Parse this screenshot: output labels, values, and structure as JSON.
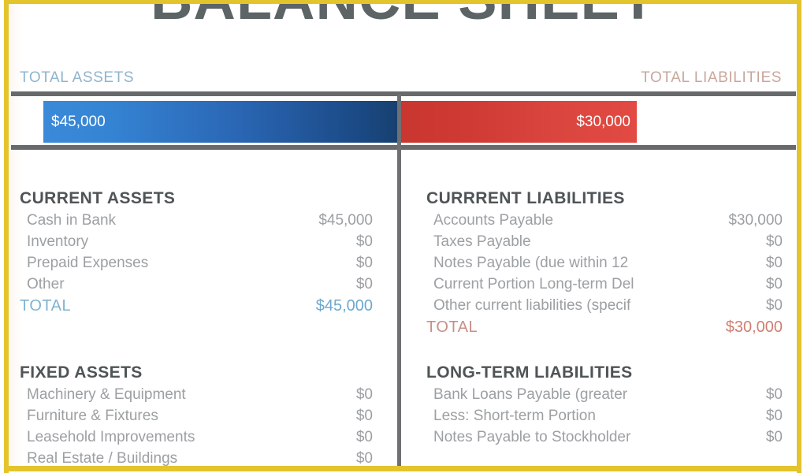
{
  "document": {
    "title": "BALANCE SHEET",
    "border_color": "#e3c42c",
    "background": "#ffffff"
  },
  "summary": {
    "assets_label": "TOTAL ASSETS",
    "assets_value": "$45,000",
    "assets_color": "#2a66b4",
    "liabilities_label": "TOTAL LIABILITIES",
    "liabilities_value": "$30,000",
    "liabilities_color": "#cf3b34"
  },
  "left_column": {
    "sections": [
      {
        "title": "CURRENT ASSETS",
        "rows": [
          {
            "label": "Cash in Bank",
            "value": "$45,000"
          },
          {
            "label": "Inventory",
            "value": "$0"
          },
          {
            "label": "Prepaid Expenses",
            "value": "$0"
          },
          {
            "label": "Other",
            "value": "$0"
          }
        ],
        "total_label": "TOTAL",
        "total_value": "$45,000"
      },
      {
        "title": "FIXED ASSETS",
        "rows": [
          {
            "label": "Machinery & Equipment",
            "value": "$0"
          },
          {
            "label": "Furniture & Fixtures",
            "value": "$0"
          },
          {
            "label": "Leasehold Improvements",
            "value": "$0"
          },
          {
            "label": "Real Estate / Buildings",
            "value": "$0"
          }
        ]
      }
    ]
  },
  "right_column": {
    "sections": [
      {
        "title": "CURRRENT LIABILITIES",
        "rows": [
          {
            "label": "Accounts Payable",
            "value": "$30,000"
          },
          {
            "label": "Taxes Payable",
            "value": "$0"
          },
          {
            "label": "Notes Payable (due within 12",
            "value": "$0"
          },
          {
            "label": "Current Portion Long-term Del",
            "value": "$0"
          },
          {
            "label": "Other current liabilities (specif",
            "value": "$0"
          }
        ],
        "total_label": "TOTAL",
        "total_value": "$30,000"
      },
      {
        "title": "LONG-TERM LIABILITIES",
        "rows": [
          {
            "label": "Bank Loans Payable (greater",
            "value": "$0"
          },
          {
            "label": "Less: Short-term Portion",
            "value": "$0"
          },
          {
            "label": "Notes Payable to Stockholder",
            "value": "$0"
          }
        ]
      }
    ]
  },
  "chart_data": {
    "type": "bar",
    "title": "BALANCE SHEET",
    "orientation": "horizontal-stacked",
    "categories": [
      "TOTAL ASSETS",
      "TOTAL LIABILITIES"
    ],
    "values": [
      45000,
      30000
    ],
    "value_labels": [
      "$45,000",
      "$30,000"
    ],
    "colors": [
      "#2a66b4",
      "#cf3b34"
    ],
    "grid": false,
    "legend": "none"
  }
}
